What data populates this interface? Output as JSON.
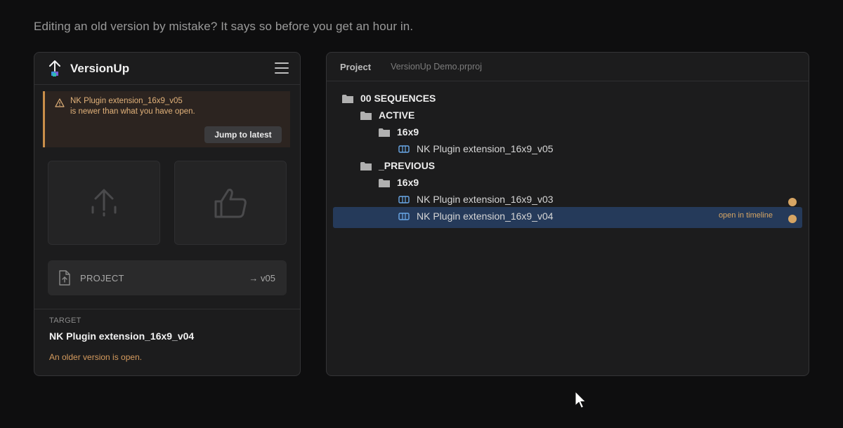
{
  "caption": "Editing an old version by mistake? It says so before you get an hour in.",
  "app": {
    "title": "VersionUp"
  },
  "warning": {
    "line1": "NK Plugin extension_16x9_v05",
    "line2": "is newer than what you have open.",
    "button": "Jump to latest"
  },
  "project_row": {
    "label": "PROJECT",
    "version": "→ v05"
  },
  "target": {
    "label": "TARGET",
    "name": "NK Plugin extension_16x9_v04",
    "status": "An older version is open."
  },
  "project_panel": {
    "title": "Project",
    "file": "VersionUp Demo.prproj",
    "tree": [
      {
        "label": "00 SEQUENCES",
        "type": "folder",
        "depth": 0
      },
      {
        "label": "ACTIVE",
        "type": "folder",
        "depth": 1
      },
      {
        "label": "16x9",
        "type": "folder",
        "depth": 2
      },
      {
        "label": "NK Plugin extension_16x9_v05",
        "type": "sequence",
        "depth": 3
      },
      {
        "label": "_PREVIOUS",
        "type": "folder",
        "depth": 1
      },
      {
        "label": "16x9",
        "type": "folder",
        "depth": 2
      },
      {
        "label": "NK Plugin extension_16x9_v03",
        "type": "sequence",
        "depth": 3
      },
      {
        "label": "NK Plugin extension_16x9_v04",
        "type": "sequence",
        "depth": 3,
        "selected": true
      }
    ],
    "open_label": "open in timeline"
  },
  "colors": {
    "accent_warning": "#d6a564",
    "selection": "#253a5a",
    "background": "#0e0e0f",
    "panel": "#1c1c1d"
  }
}
